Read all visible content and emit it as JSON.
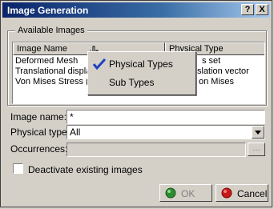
{
  "window": {
    "title": "Image Generation",
    "help_label": "?",
    "close_label": "X"
  },
  "available_images": {
    "group_label": "Available Images",
    "columns": [
      "Image Name",
      "Physical Type"
    ],
    "rows": [
      {
        "name": "Deformed Mesh",
        "type": "Nodes set"
      },
      {
        "name": "Translational displa",
        "type": "Translation vector"
      },
      {
        "name": "Von Mises Stress (n",
        "type": "Von Mises"
      }
    ],
    "partial_type_cells": [
      "s set",
      "slation vector",
      "on Mises"
    ]
  },
  "context_menu": {
    "items": [
      {
        "label": "Physical Types",
        "checked": true
      },
      {
        "label": "Sub Types",
        "checked": false
      }
    ]
  },
  "form": {
    "image_name_label": "Image name:",
    "image_name_value": "*",
    "physical_type_label": "Physical type:",
    "physical_type_value": "All",
    "occurrences_label": "Occurrences:",
    "occurrences_value": "",
    "ellipsis_label": "..."
  },
  "deactivate": {
    "label": "Deactivate existing images",
    "checked": false
  },
  "buttons": {
    "ok_label": "OK",
    "cancel_label": "Cancel"
  },
  "colors": {
    "title_bar_start": "#0a246a",
    "title_bar_end": "#a6caf0",
    "ok_icon": "#2e8b2e",
    "cancel_icon": "#c81818",
    "check_mark": "#2040c0"
  }
}
